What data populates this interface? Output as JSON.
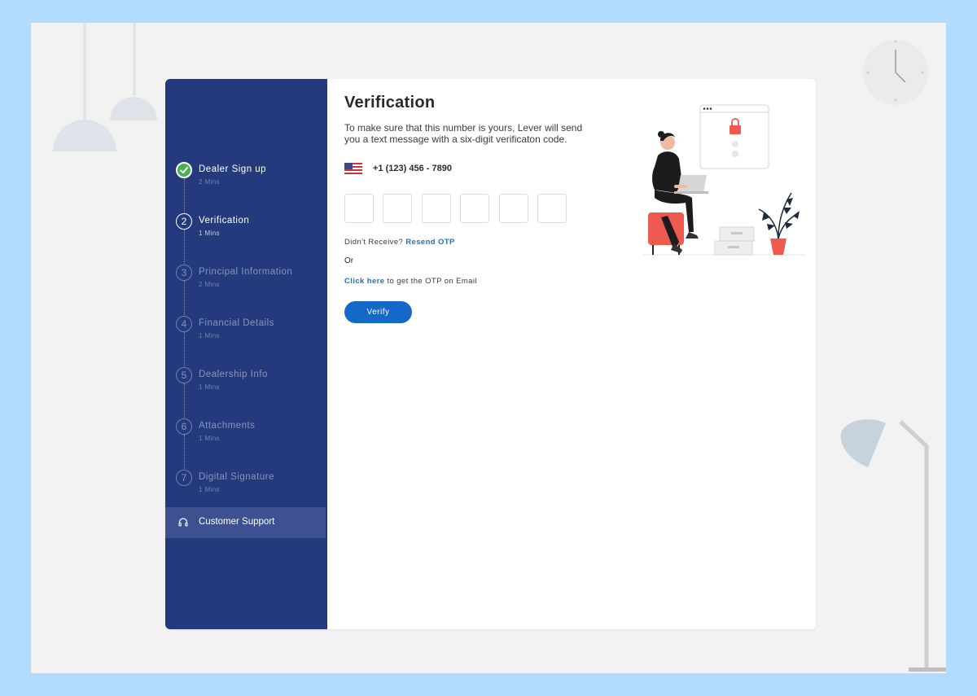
{
  "sidebar": {
    "steps": [
      {
        "number": "✓",
        "title": "Dealer Sign up",
        "duration": "2 Mins",
        "state": "done"
      },
      {
        "number": "2",
        "title": "Verification",
        "duration": "1 Mins",
        "state": "current"
      },
      {
        "number": "3",
        "title": "Principal Information",
        "duration": "2 Mins",
        "state": "pending"
      },
      {
        "number": "4",
        "title": "Financial Details",
        "duration": "1 Mins",
        "state": "pending"
      },
      {
        "number": "5",
        "title": "Dealership Info",
        "duration": "1 Mins",
        "state": "pending"
      },
      {
        "number": "6",
        "title": "Attachments",
        "duration": "1 Mins",
        "state": "pending"
      },
      {
        "number": "7",
        "title": "Digital Signature",
        "duration": "1 Mins",
        "state": "pending"
      }
    ],
    "support_label": "Customer Support",
    "support_icon": "headset-icon"
  },
  "main": {
    "title": "Verification",
    "description": "To make sure that this number is yours, Lever will send you a text message with a six-digit verificaton code.",
    "flag_icon": "us-flag-icon",
    "phone": "+1   (123) 456 - 7890",
    "otp_digits": [
      "",
      "",
      "",
      "",
      "",
      ""
    ],
    "resend_prefix": "Didn't Receive?",
    "resend_link": "Resend OTP",
    "or_text": "Or",
    "email_link": "Click here",
    "email_suffix": "to get the OTP on Email",
    "verify_label": "Verify"
  },
  "colors": {
    "sidebar": "#253a7d",
    "accent": "#1468c8",
    "success": "#4caf50",
    "illustration_red": "#ee5a4f",
    "outer_background": "#b1dcfd"
  }
}
